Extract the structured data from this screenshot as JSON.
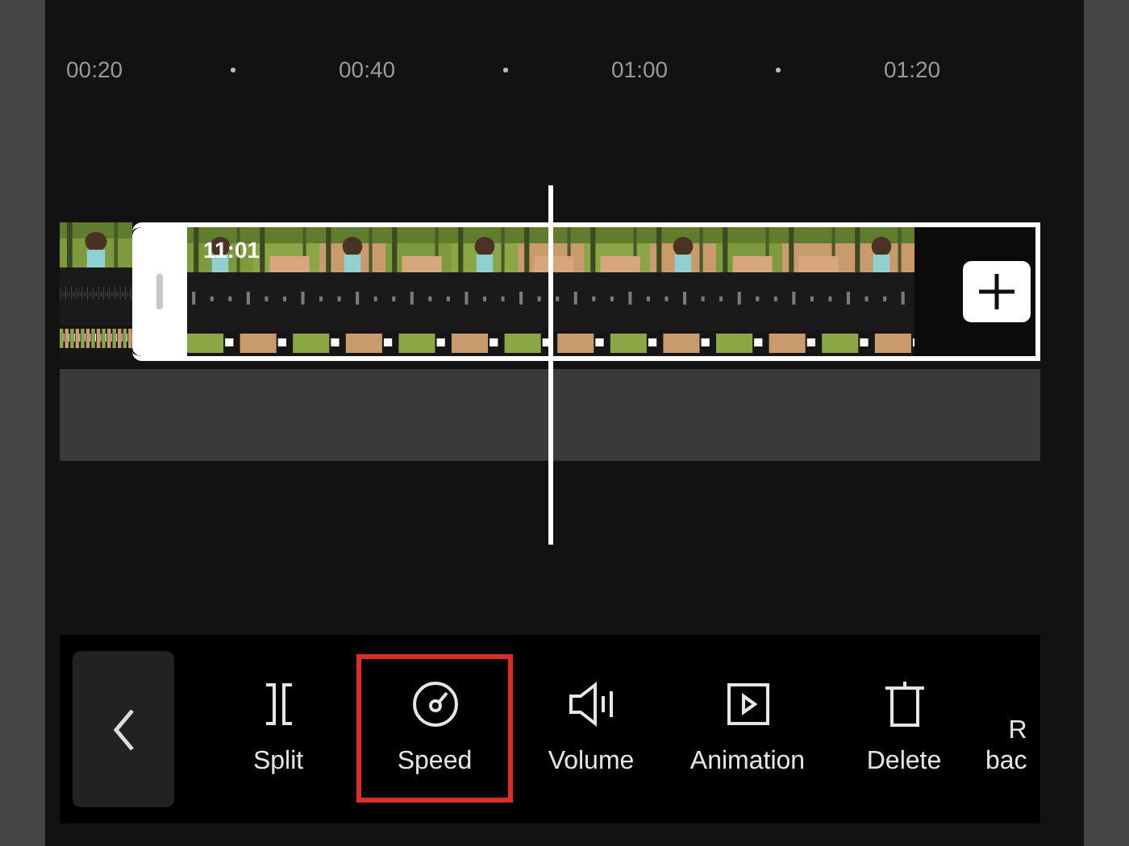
{
  "ruler": {
    "ticks": [
      "00:20",
      "00:40",
      "01:00",
      "01:20"
    ]
  },
  "clip": {
    "duration": "11:01",
    "selected": true
  },
  "toolbar": {
    "items": [
      {
        "kind": "split",
        "label": "Split",
        "selected": false
      },
      {
        "kind": "speed",
        "label": "Speed",
        "selected": true
      },
      {
        "kind": "volume",
        "label": "Volume",
        "selected": false
      },
      {
        "kind": "animation",
        "label": "Animation",
        "selected": false
      },
      {
        "kind": "delete",
        "label": "Delete",
        "selected": false
      },
      {
        "kind": "cut",
        "label": "R\nbac",
        "selected": false
      }
    ]
  }
}
